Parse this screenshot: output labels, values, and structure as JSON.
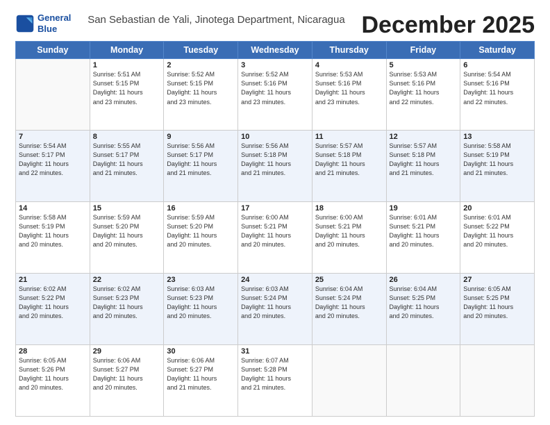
{
  "logo": {
    "line1": "General",
    "line2": "Blue"
  },
  "title": "December 2025",
  "subtitle": "San Sebastian de Yali, Jinotega Department, Nicaragua",
  "days": [
    "Sunday",
    "Monday",
    "Tuesday",
    "Wednesday",
    "Thursday",
    "Friday",
    "Saturday"
  ],
  "weeks": [
    [
      {
        "num": "",
        "sunrise": "",
        "sunset": "",
        "daylight": ""
      },
      {
        "num": "1",
        "sunrise": "Sunrise: 5:51 AM",
        "sunset": "Sunset: 5:15 PM",
        "daylight": "Daylight: 11 hours and 23 minutes."
      },
      {
        "num": "2",
        "sunrise": "Sunrise: 5:52 AM",
        "sunset": "Sunset: 5:15 PM",
        "daylight": "Daylight: 11 hours and 23 minutes."
      },
      {
        "num": "3",
        "sunrise": "Sunrise: 5:52 AM",
        "sunset": "Sunset: 5:16 PM",
        "daylight": "Daylight: 11 hours and 23 minutes."
      },
      {
        "num": "4",
        "sunrise": "Sunrise: 5:53 AM",
        "sunset": "Sunset: 5:16 PM",
        "daylight": "Daylight: 11 hours and 23 minutes."
      },
      {
        "num": "5",
        "sunrise": "Sunrise: 5:53 AM",
        "sunset": "Sunset: 5:16 PM",
        "daylight": "Daylight: 11 hours and 22 minutes."
      },
      {
        "num": "6",
        "sunrise": "Sunrise: 5:54 AM",
        "sunset": "Sunset: 5:16 PM",
        "daylight": "Daylight: 11 hours and 22 minutes."
      }
    ],
    [
      {
        "num": "7",
        "sunrise": "Sunrise: 5:54 AM",
        "sunset": "Sunset: 5:17 PM",
        "daylight": "Daylight: 11 hours and 22 minutes."
      },
      {
        "num": "8",
        "sunrise": "Sunrise: 5:55 AM",
        "sunset": "Sunset: 5:17 PM",
        "daylight": "Daylight: 11 hours and 21 minutes."
      },
      {
        "num": "9",
        "sunrise": "Sunrise: 5:56 AM",
        "sunset": "Sunset: 5:17 PM",
        "daylight": "Daylight: 11 hours and 21 minutes."
      },
      {
        "num": "10",
        "sunrise": "Sunrise: 5:56 AM",
        "sunset": "Sunset: 5:18 PM",
        "daylight": "Daylight: 11 hours and 21 minutes."
      },
      {
        "num": "11",
        "sunrise": "Sunrise: 5:57 AM",
        "sunset": "Sunset: 5:18 PM",
        "daylight": "Daylight: 11 hours and 21 minutes."
      },
      {
        "num": "12",
        "sunrise": "Sunrise: 5:57 AM",
        "sunset": "Sunset: 5:18 PM",
        "daylight": "Daylight: 11 hours and 21 minutes."
      },
      {
        "num": "13",
        "sunrise": "Sunrise: 5:58 AM",
        "sunset": "Sunset: 5:19 PM",
        "daylight": "Daylight: 11 hours and 21 minutes."
      }
    ],
    [
      {
        "num": "14",
        "sunrise": "Sunrise: 5:58 AM",
        "sunset": "Sunset: 5:19 PM",
        "daylight": "Daylight: 11 hours and 20 minutes."
      },
      {
        "num": "15",
        "sunrise": "Sunrise: 5:59 AM",
        "sunset": "Sunset: 5:20 PM",
        "daylight": "Daylight: 11 hours and 20 minutes."
      },
      {
        "num": "16",
        "sunrise": "Sunrise: 5:59 AM",
        "sunset": "Sunset: 5:20 PM",
        "daylight": "Daylight: 11 hours and 20 minutes."
      },
      {
        "num": "17",
        "sunrise": "Sunrise: 6:00 AM",
        "sunset": "Sunset: 5:21 PM",
        "daylight": "Daylight: 11 hours and 20 minutes."
      },
      {
        "num": "18",
        "sunrise": "Sunrise: 6:00 AM",
        "sunset": "Sunset: 5:21 PM",
        "daylight": "Daylight: 11 hours and 20 minutes."
      },
      {
        "num": "19",
        "sunrise": "Sunrise: 6:01 AM",
        "sunset": "Sunset: 5:21 PM",
        "daylight": "Daylight: 11 hours and 20 minutes."
      },
      {
        "num": "20",
        "sunrise": "Sunrise: 6:01 AM",
        "sunset": "Sunset: 5:22 PM",
        "daylight": "Daylight: 11 hours and 20 minutes."
      }
    ],
    [
      {
        "num": "21",
        "sunrise": "Sunrise: 6:02 AM",
        "sunset": "Sunset: 5:22 PM",
        "daylight": "Daylight: 11 hours and 20 minutes."
      },
      {
        "num": "22",
        "sunrise": "Sunrise: 6:02 AM",
        "sunset": "Sunset: 5:23 PM",
        "daylight": "Daylight: 11 hours and 20 minutes."
      },
      {
        "num": "23",
        "sunrise": "Sunrise: 6:03 AM",
        "sunset": "Sunset: 5:23 PM",
        "daylight": "Daylight: 11 hours and 20 minutes."
      },
      {
        "num": "24",
        "sunrise": "Sunrise: 6:03 AM",
        "sunset": "Sunset: 5:24 PM",
        "daylight": "Daylight: 11 hours and 20 minutes."
      },
      {
        "num": "25",
        "sunrise": "Sunrise: 6:04 AM",
        "sunset": "Sunset: 5:24 PM",
        "daylight": "Daylight: 11 hours and 20 minutes."
      },
      {
        "num": "26",
        "sunrise": "Sunrise: 6:04 AM",
        "sunset": "Sunset: 5:25 PM",
        "daylight": "Daylight: 11 hours and 20 minutes."
      },
      {
        "num": "27",
        "sunrise": "Sunrise: 6:05 AM",
        "sunset": "Sunset: 5:25 PM",
        "daylight": "Daylight: 11 hours and 20 minutes."
      }
    ],
    [
      {
        "num": "28",
        "sunrise": "Sunrise: 6:05 AM",
        "sunset": "Sunset: 5:26 PM",
        "daylight": "Daylight: 11 hours and 20 minutes."
      },
      {
        "num": "29",
        "sunrise": "Sunrise: 6:06 AM",
        "sunset": "Sunset: 5:27 PM",
        "daylight": "Daylight: 11 hours and 20 minutes."
      },
      {
        "num": "30",
        "sunrise": "Sunrise: 6:06 AM",
        "sunset": "Sunset: 5:27 PM",
        "daylight": "Daylight: 11 hours and 21 minutes."
      },
      {
        "num": "31",
        "sunrise": "Sunrise: 6:07 AM",
        "sunset": "Sunset: 5:28 PM",
        "daylight": "Daylight: 11 hours and 21 minutes."
      },
      {
        "num": "",
        "sunrise": "",
        "sunset": "",
        "daylight": ""
      },
      {
        "num": "",
        "sunrise": "",
        "sunset": "",
        "daylight": ""
      },
      {
        "num": "",
        "sunrise": "",
        "sunset": "",
        "daylight": ""
      }
    ]
  ]
}
